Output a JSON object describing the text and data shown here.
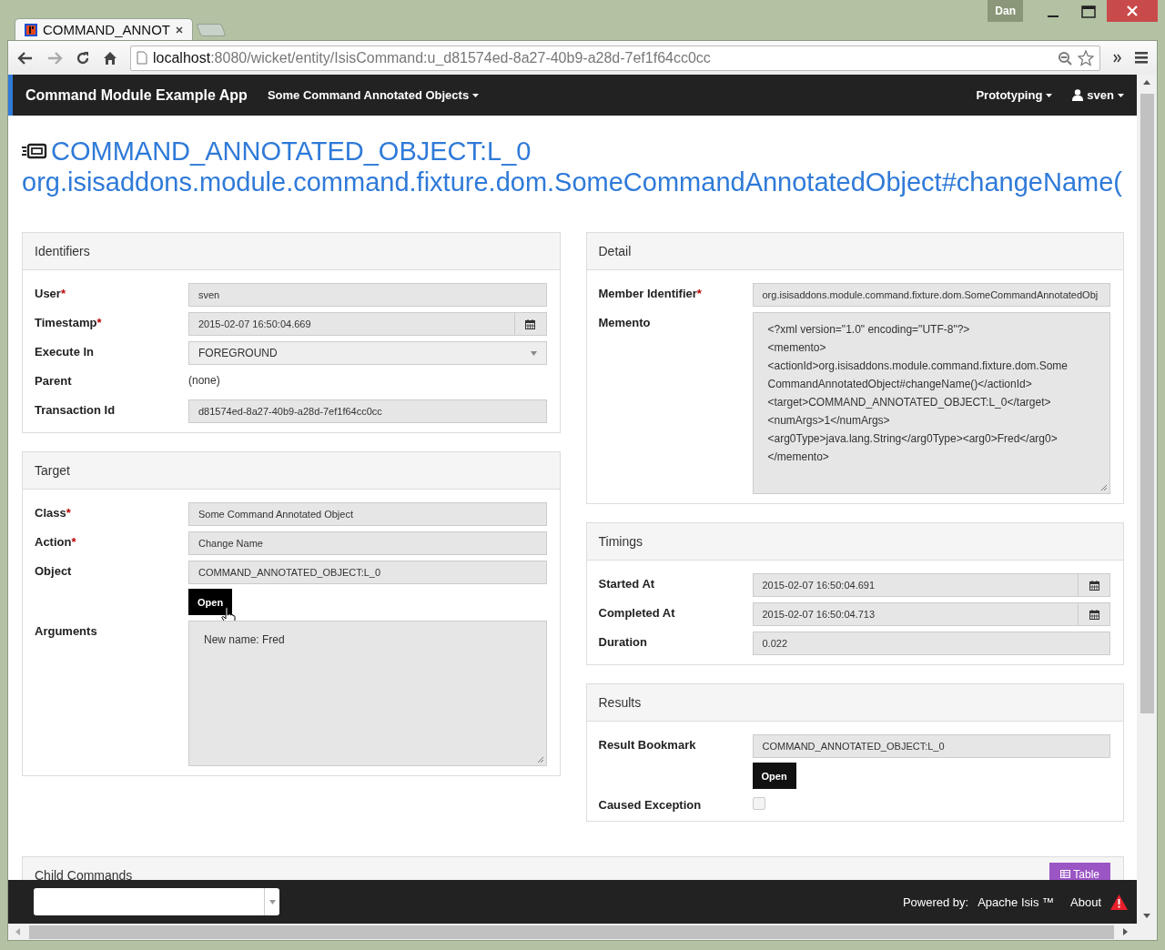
{
  "browser": {
    "tab_title": "COMMAND_ANNOT",
    "profile": "Dan",
    "url_host": "localhost",
    "url_path": ":8080/wicket/entity/IsisCommand:u_d81574ed-8a27-40b9-a28d-7ef1f64cc0cc"
  },
  "navbar": {
    "brand": "Command Module Example App",
    "left_menus": [
      {
        "label": "Some Command Annotated Objects",
        "kind": "menu"
      }
    ],
    "right_menus": [
      {
        "label": "Prototyping",
        "kind": "menu"
      },
      {
        "label": "sven",
        "kind": "user"
      }
    ]
  },
  "title": {
    "object": "COMMAND_ANNOTATED_OBJECT:L_0",
    "member": "org.isisaddons.module.command.fixture.dom.SomeCommandAnnotatedObject#changeName("
  },
  "columns": [
    [
      {
        "title": "Identifiers",
        "fields": [
          {
            "label": "User",
            "mark": "*",
            "kind": "text",
            "value": "sven"
          },
          {
            "label": "Timestamp",
            "mark": "*",
            "kind": "date",
            "value": "2015-02-07 16:50:04.669"
          },
          {
            "label": "Execute In",
            "kind": "select",
            "value": "FOREGROUND"
          },
          {
            "label": "Parent",
            "kind": "plain",
            "value": "(none)"
          },
          {
            "label": "Transaction Id",
            "kind": "text",
            "value": "d81574ed-8a27-40b9-a28d-7ef1f64cc0cc"
          }
        ]
      },
      {
        "title": "Target",
        "fields": [
          {
            "label": "Class",
            "mark": "*",
            "kind": "text",
            "value": "Some Command Annotated Object"
          },
          {
            "label": "Action",
            "mark": "*",
            "kind": "text",
            "value": "Change Name"
          },
          {
            "label": "Object",
            "kind": "text",
            "value": "COMMAND_ANNOTATED_OBJECT:L_0",
            "button": "Open",
            "hovered": true
          },
          {
            "label": "Arguments",
            "kind": "textarea",
            "lines": [
              "New name: Fred"
            ]
          }
        ]
      }
    ],
    [
      {
        "title": "Detail",
        "fields": [
          {
            "label": "Member Identifier",
            "mark": "*",
            "kind": "text",
            "value": "org.isisaddons.module.command.fixture.dom.SomeCommandAnnotatedObj"
          },
          {
            "label": "Memento",
            "kind": "textarea",
            "lines": [
              "<?xml version=\"1.0\" encoding=\"UTF-8\"?>",
              "<memento>",
              "<actionId>org.isisaddons.module.command.fixture.dom.Some",
              "CommandAnnotatedObject#changeName()</actionId>",
              "<target>COMMAND_ANNOTATED_OBJECT:L_0</target>",
              "<numArgs>1</numArgs>",
              "<arg0Type>java.lang.String</arg0Type><arg0>Fred</arg0>",
              "</memento>"
            ]
          }
        ]
      },
      {
        "title": "Timings",
        "fields": [
          {
            "label": "Started At",
            "kind": "date",
            "value": "2015-02-07 16:50:04.691"
          },
          {
            "label": "Completed At",
            "kind": "date",
            "value": "2015-02-07 16:50:04.713"
          },
          {
            "label": "Duration",
            "kind": "text",
            "value": "0.022"
          }
        ]
      },
      {
        "title": "Results",
        "fields": [
          {
            "label": "Result Bookmark",
            "kind": "text",
            "value": "COMMAND_ANNOTATED_OBJECT:L_0",
            "button": "Open",
            "hovered": false
          },
          {
            "label": "Caused Exception",
            "kind": "checkbox",
            "checked": false
          }
        ]
      }
    ]
  ],
  "child_commands": {
    "title": "Child Commands",
    "button": "Table"
  },
  "footer": {
    "powered_by": "Powered by:",
    "link": "Apache Isis ™",
    "about": "About"
  }
}
